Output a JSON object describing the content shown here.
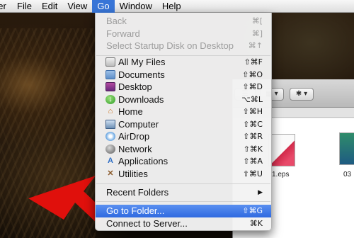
{
  "menubar": {
    "items": [
      {
        "label": "Finder",
        "active": false
      },
      {
        "label": "File",
        "active": false
      },
      {
        "label": "Edit",
        "active": false
      },
      {
        "label": "View",
        "active": false
      },
      {
        "label": "Go",
        "active": true
      },
      {
        "label": "Window",
        "active": false
      },
      {
        "label": "Help",
        "active": false
      }
    ]
  },
  "go_menu": {
    "navigation": [
      {
        "label": "Back",
        "shortcut": "⌘[",
        "enabled": false
      },
      {
        "label": "Forward",
        "shortcut": "⌘]",
        "enabled": false
      },
      {
        "label": "Select Startup Disk on Desktop",
        "shortcut": "⌘↑",
        "enabled": false
      }
    ],
    "locations": [
      {
        "label": "All My Files",
        "shortcut": "⇧⌘F",
        "icon": "all-my-files-icon"
      },
      {
        "label": "Documents",
        "shortcut": "⇧⌘O",
        "icon": "documents-icon"
      },
      {
        "label": "Desktop",
        "shortcut": "⇧⌘D",
        "icon": "desktop-icon"
      },
      {
        "label": "Downloads",
        "shortcut": "⌥⌘L",
        "icon": "downloads-icon"
      },
      {
        "label": "Home",
        "shortcut": "⇧⌘H",
        "icon": "home-icon"
      },
      {
        "label": "Computer",
        "shortcut": "⇧⌘C",
        "icon": "computer-icon"
      },
      {
        "label": "AirDrop",
        "shortcut": "⇧⌘R",
        "icon": "airdrop-icon"
      },
      {
        "label": "Network",
        "shortcut": "⇧⌘K",
        "icon": "network-icon"
      },
      {
        "label": "Applications",
        "shortcut": "⇧⌘A",
        "icon": "applications-icon"
      },
      {
        "label": "Utilities",
        "shortcut": "⇧⌘U",
        "icon": "utilities-icon"
      }
    ],
    "recent_folders": {
      "label": "Recent Folders",
      "submenu_arrow": "▶"
    },
    "go_to_folder": {
      "label": "Go to Folder...",
      "shortcut": "⇧⌘G",
      "highlighted": true
    },
    "connect_to_server": {
      "label": "Connect to Server...",
      "shortcut": "⌘K"
    }
  },
  "finder_window": {
    "files": [
      {
        "label": "1.eps"
      },
      {
        "label": "03"
      }
    ]
  },
  "colors": {
    "menu_highlight": "#3875d7",
    "arrow": "#e0100c"
  }
}
